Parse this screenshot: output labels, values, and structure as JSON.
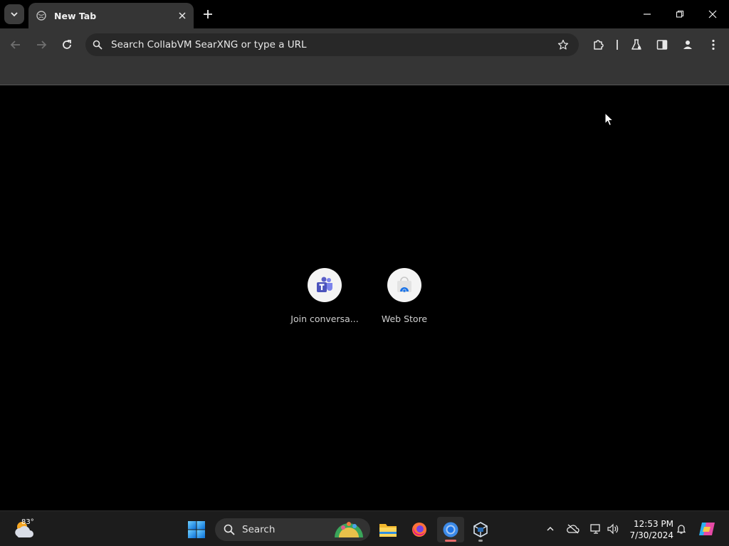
{
  "browser": {
    "active_tab_title": "New Tab",
    "omnibox_placeholder": "Search CollabVM SearXNG or type a URL"
  },
  "shortcuts": [
    {
      "label": "Join conversa...",
      "icon": "teams-icon"
    },
    {
      "label": "Web Store",
      "icon": "chrome-web-store-icon"
    }
  ],
  "taskbar": {
    "weather_temp": "83°",
    "search_label": "Search",
    "clock_time": "12:53 PM",
    "clock_date": "7/30/2024",
    "apps": [
      "file-explorer",
      "firefox",
      "chrome",
      "virtualbox"
    ]
  },
  "colors": {
    "chrome_accent": "#1a73e8",
    "teams_purple": "#5b5fc7",
    "active_indicator": "#e86a6a"
  }
}
